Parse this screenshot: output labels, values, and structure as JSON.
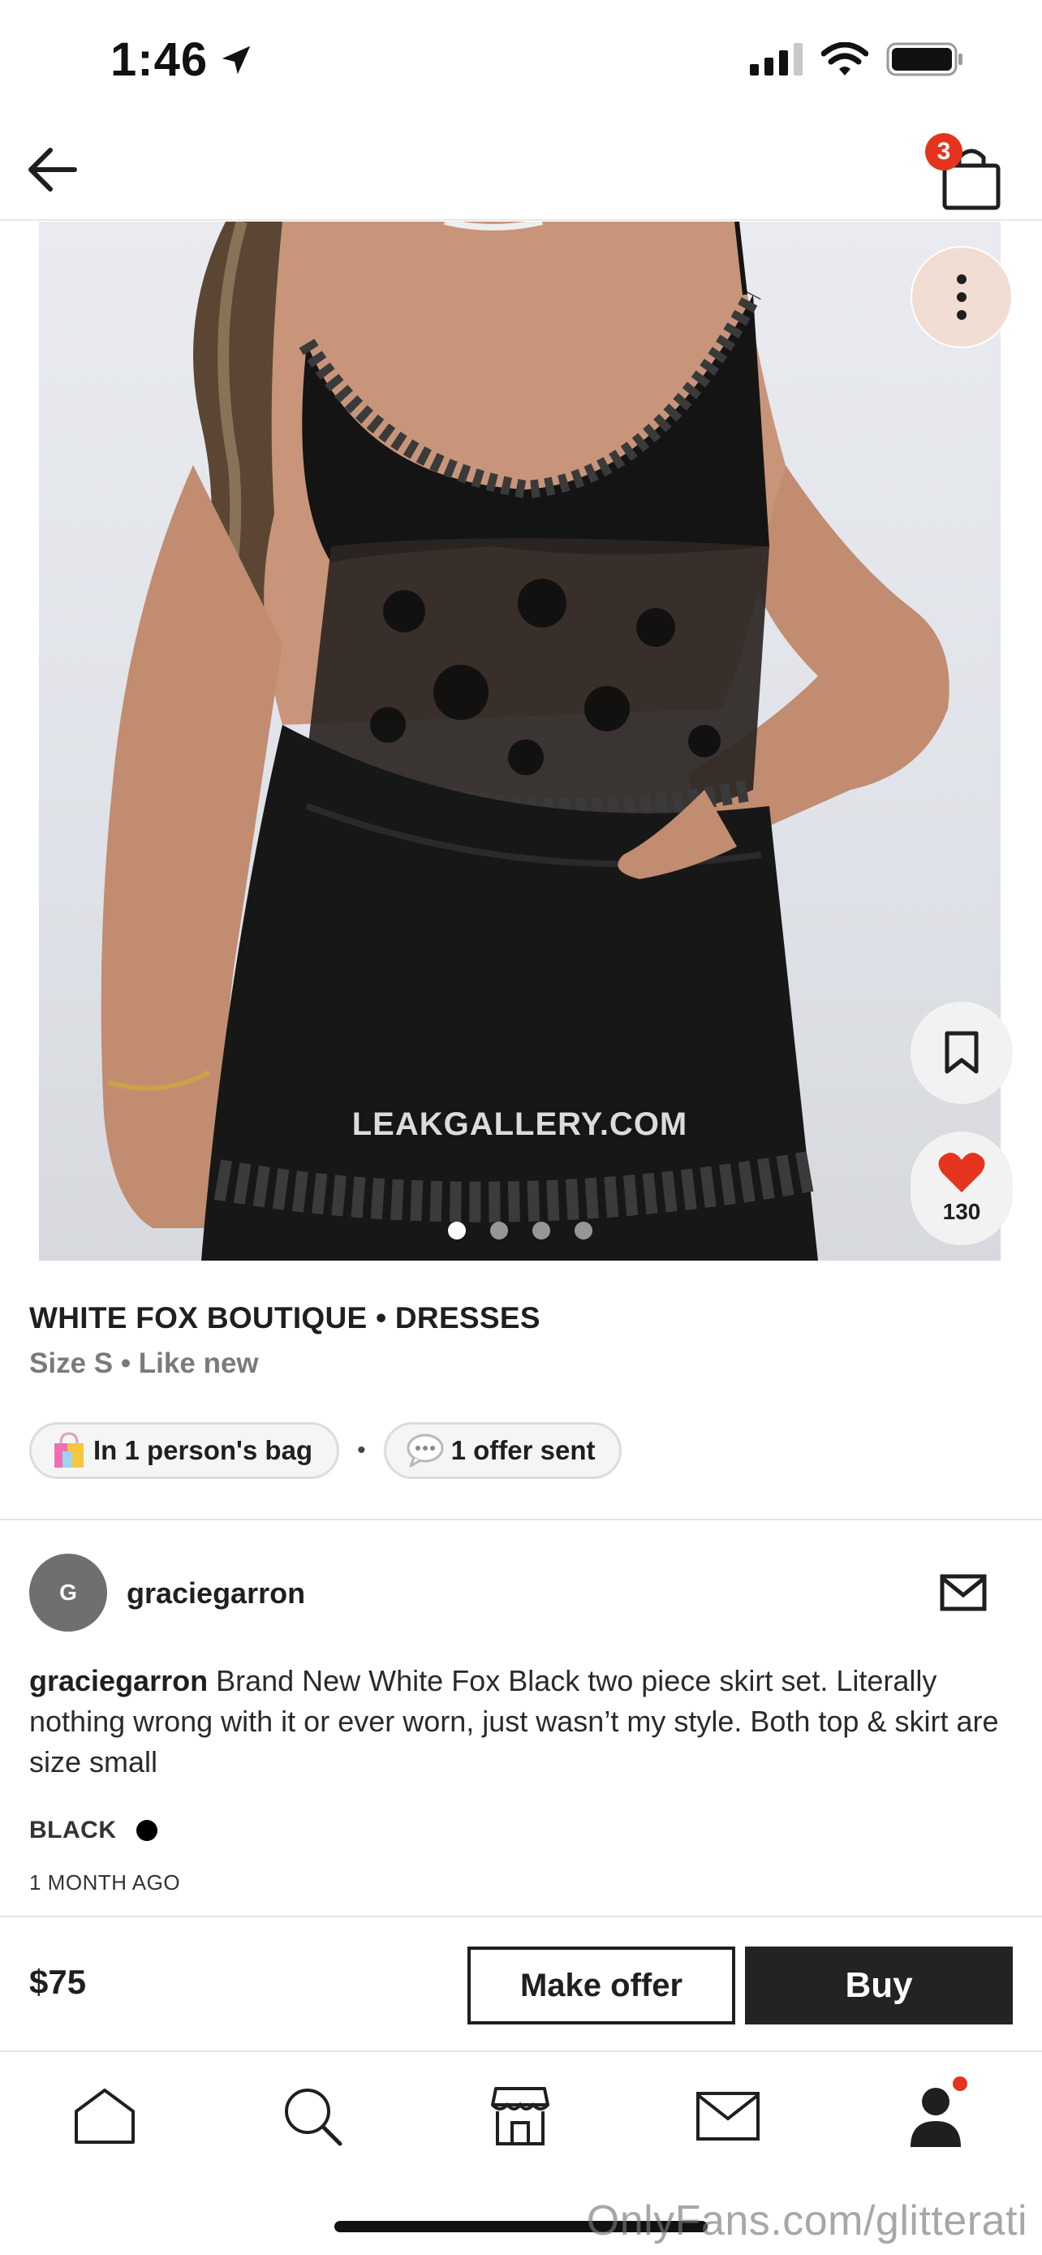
{
  "status_bar": {
    "time": "1:46"
  },
  "top_nav": {
    "bag_count": "3"
  },
  "photo": {
    "watermark": "LEAKGALLERY.COM",
    "dots": 4,
    "active_dot": 0,
    "likes": "130"
  },
  "listing": {
    "title": "WHITE FOX BOUTIQUE • DRESSES",
    "subtitle": "Size S • Like new",
    "chips": [
      {
        "icon": "shopping-bag-emoji-icon",
        "label": "In 1 person's bag"
      },
      {
        "icon": "speech-bubble-icon",
        "label": "1 offer sent"
      }
    ],
    "chip_separator": "•"
  },
  "seller": {
    "avatar_initial": "G",
    "username": "graciegarron"
  },
  "description": {
    "author": "graciegarron",
    "text": " Brand New White Fox Black two piece skirt set. Literally nothing wrong with it or ever worn, just wasn’t my style. Both top & skirt are size small"
  },
  "details": {
    "color_label": "BLACK",
    "color_hex": "#000000",
    "posted": "1 MONTH AGO"
  },
  "buy_bar": {
    "price": "$75",
    "offer_label": "Make offer",
    "buy_label": "Buy"
  },
  "tabs": [
    {
      "name": "home"
    },
    {
      "name": "search"
    },
    {
      "name": "shop"
    },
    {
      "name": "inbox"
    },
    {
      "name": "profile",
      "has_notification": true
    }
  ],
  "footer_watermark": "OnlyFans.com/glitterati",
  "colors": {
    "accent_red": "#e5341d",
    "dark_button": "#232323"
  }
}
